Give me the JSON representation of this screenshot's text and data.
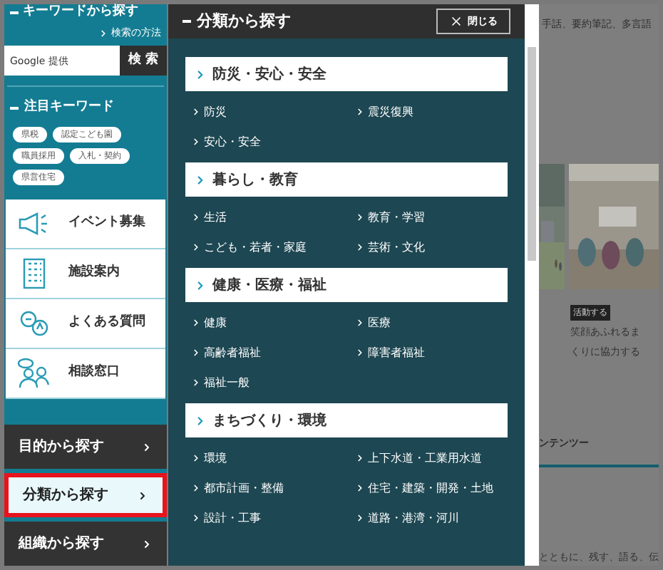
{
  "sidebar": {
    "keyword_heading": "キーワードから探す",
    "search_help": "検索の方法",
    "search": {
      "placeholder": "Google 提供",
      "button": "検 索"
    },
    "featured_heading": "注目キーワード",
    "tags": [
      "県税",
      "認定こども園",
      "職員採用",
      "入札・契約",
      "県営住宅"
    ],
    "menu": [
      {
        "label": "イベント募集",
        "kind": "megaphone"
      },
      {
        "label": "施設案内",
        "kind": "building"
      },
      {
        "label": "よくある質問",
        "kind": "qa"
      },
      {
        "label": "相談窓口",
        "kind": "people"
      }
    ],
    "nav": [
      {
        "label": "目的から探す",
        "selected": false
      },
      {
        "label": "分類から探す",
        "selected": true
      },
      {
        "label": "組織から探す",
        "selected": false
      }
    ]
  },
  "panel": {
    "title": "分類から探す",
    "close": "閉じる",
    "sections": [
      {
        "title": "防災・安心・安全",
        "items": [
          "防災",
          "震災復興",
          "安心・安全"
        ]
      },
      {
        "title": "暮らし・教育",
        "items": [
          "生活",
          "教育・学習",
          "こども・若者・家庭",
          "芸術・文化"
        ]
      },
      {
        "title": "健康・医療・福祉",
        "items": [
          "健康",
          "医療",
          "高齢者福祉",
          "障害者福祉",
          "福祉一般"
        ]
      },
      {
        "title": "まちづくり・環境",
        "items": [
          "環境",
          "上下水道・工業用水道",
          "都市計画・整備",
          "住宅・建築・開発・土地",
          "設計・工事",
          "道路・港湾・河川"
        ]
      }
    ]
  },
  "background": {
    "intro": "手話、要約筆記、多言語",
    "badge": "活動する",
    "caption": [
      "笑顔あふれるま",
      "くりに協力する"
    ],
    "heading": "ンテンツー",
    "text": "とともに、残す、語る、伝"
  }
}
